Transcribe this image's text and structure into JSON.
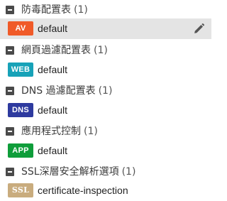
{
  "groups": [
    {
      "title": "防毒配置表",
      "count": "(1)",
      "items": [
        {
          "badge": "AV",
          "badge_color": "#f05a28",
          "label": "default",
          "selected": true,
          "icon": "pencil-icon"
        }
      ]
    },
    {
      "title": "網頁過濾配置表",
      "count": "(1)",
      "items": [
        {
          "badge": "WEB",
          "badge_color": "#17a2b8",
          "label": "default",
          "selected": false
        }
      ]
    },
    {
      "title": "DNS 過濾配置表",
      "count": "(1)",
      "items": [
        {
          "badge": "DNS",
          "badge_color": "#2e3a9f",
          "label": "default",
          "selected": false
        }
      ]
    },
    {
      "title": "應用程式控制",
      "count": "(1)",
      "items": [
        {
          "badge": "APP",
          "badge_color": "#0f9d3a",
          "label": "default",
          "selected": false
        }
      ]
    },
    {
      "title": "SSL深層安全解析選項",
      "count": "(1)",
      "items": [
        {
          "badge": "SSL",
          "badge_color": "#c9ac7e",
          "label": "certificate-inspection",
          "selected": false
        }
      ]
    }
  ],
  "icons": {
    "collapse": "collapse-icon",
    "edit": "pencil-icon"
  }
}
